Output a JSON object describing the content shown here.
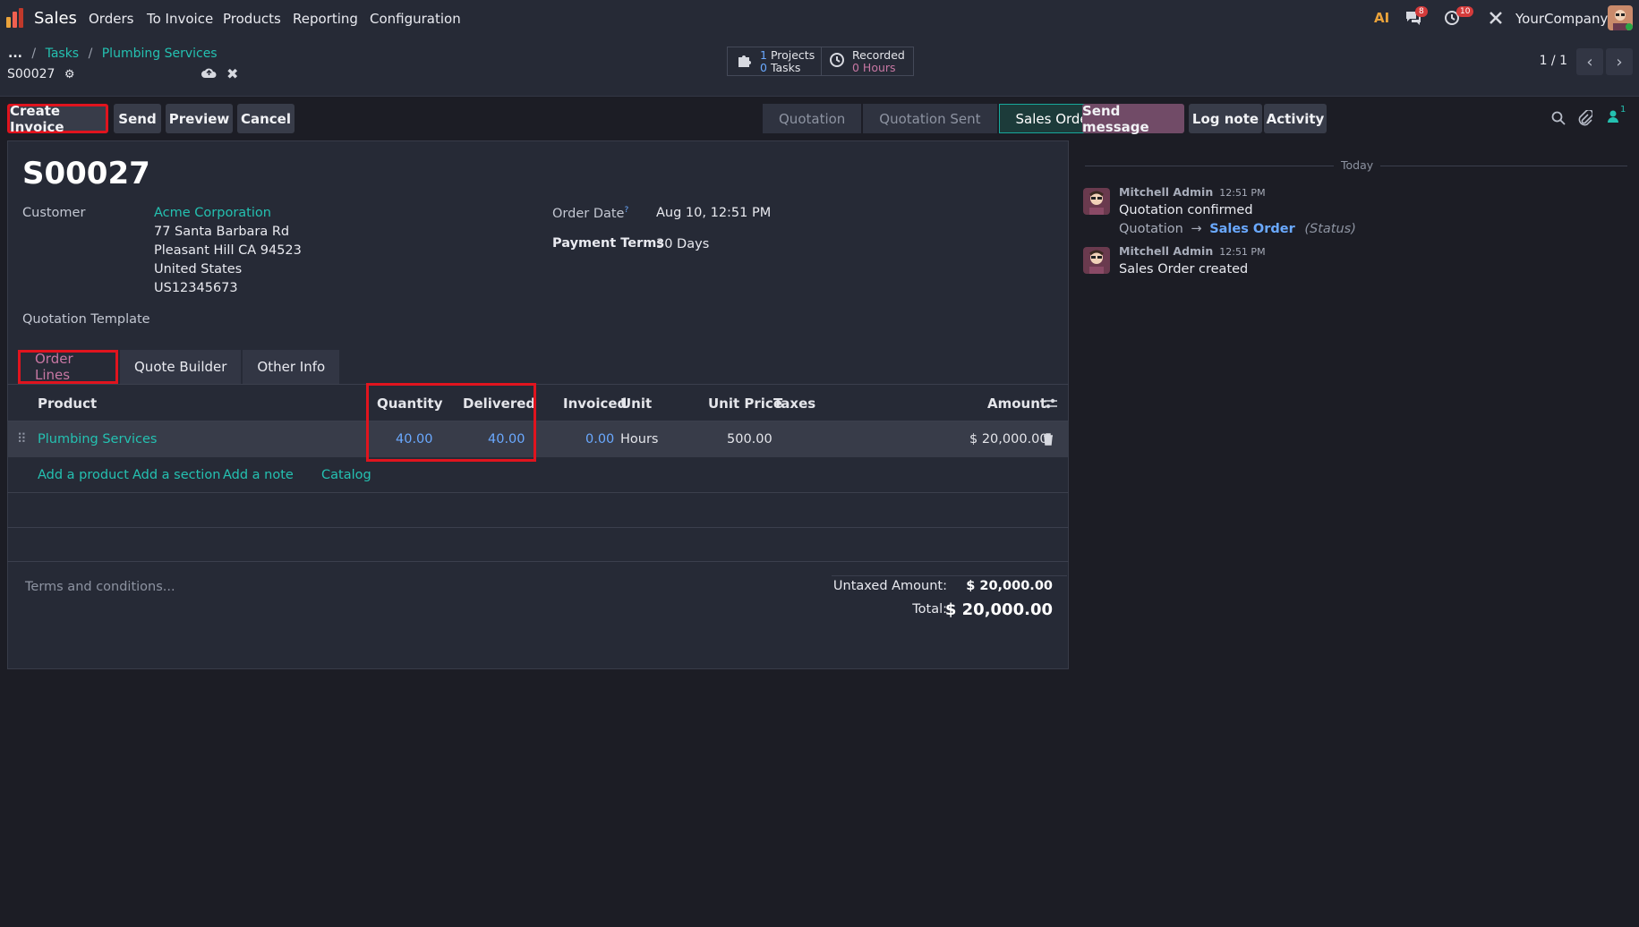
{
  "app": {
    "name": "Sales"
  },
  "menu": [
    "Orders",
    "To Invoice",
    "Products",
    "Reporting",
    "Configuration"
  ],
  "systray": {
    "messages_count": "8",
    "activities_count": "10",
    "company": "YourCompany"
  },
  "breadcrumb": {
    "ellipsis": "...",
    "sep": "/",
    "items": [
      "Tasks",
      "Plumbing Services"
    ]
  },
  "record": {
    "name": "S00027"
  },
  "smart_buttons": {
    "projects": {
      "count1": "1",
      "label1": "Projects",
      "count2": "0",
      "label2": "Tasks"
    },
    "recorded": {
      "label": "Recorded",
      "value": "0 Hours"
    }
  },
  "pager": {
    "text": "1 / 1"
  },
  "buttons": {
    "create_invoice": "Create Invoice",
    "send": "Send",
    "preview": "Preview",
    "cancel": "Cancel"
  },
  "status": {
    "steps": [
      "Quotation",
      "Quotation Sent",
      "Sales Order"
    ],
    "active": "Sales Order"
  },
  "form": {
    "title": "S00027",
    "customer_label": "Customer",
    "customer_name": "Acme Corporation",
    "address": [
      "77 Santa Barbara Rd",
      "Pleasant Hill CA 94523",
      "United States",
      "US12345673"
    ],
    "quotation_template_label": "Quotation Template",
    "order_date_label": "Order Date",
    "order_date_help": "?",
    "order_date": "Aug 10, 12:51 PM",
    "payment_terms_label": "Payment Terms",
    "payment_terms": "30 Days"
  },
  "tabs": [
    "Order Lines",
    "Quote Builder",
    "Other Info"
  ],
  "lines": {
    "headers": {
      "product": "Product",
      "quantity": "Quantity",
      "delivered": "Delivered",
      "invoiced": "Invoiced",
      "unit": "Unit",
      "unit_price": "Unit Price",
      "taxes": "Taxes",
      "amount": "Amount"
    },
    "rows": [
      {
        "product": "Plumbing Services",
        "quantity": "40.00",
        "delivered": "40.00",
        "invoiced": "0.00",
        "unit": "Hours",
        "unit_price": "500.00",
        "taxes": "",
        "amount": "$ 20,000.00"
      }
    ],
    "add_links": [
      "Add a product",
      "Add a section",
      "Add a note",
      "Catalog"
    ]
  },
  "terms_placeholder": "Terms and conditions...",
  "totals": {
    "untaxed_label": "Untaxed Amount:",
    "untaxed_value": "$ 20,000.00",
    "total_label": "Total:",
    "total_value": "$ 20,000.00"
  },
  "chatter": {
    "buttons": {
      "send_message": "Send message",
      "log_note": "Log note",
      "activity": "Activity"
    },
    "followers_count": "1",
    "date_separator": "Today",
    "messages": [
      {
        "author": "Mitchell Admin",
        "time": "12:51 PM",
        "body": "Quotation confirmed",
        "tracking_old": "Quotation",
        "tracking_arrow": "→",
        "tracking_new": "Sales Order",
        "tracking_field": "(Status)"
      },
      {
        "author": "Mitchell Admin",
        "time": "12:51 PM",
        "body": "Sales Order created"
      }
    ]
  },
  "colors": {
    "accent": "#24c1b1",
    "primary": "#714b67",
    "highlight": "#e0141e",
    "link_value": "#6aa9ff"
  }
}
